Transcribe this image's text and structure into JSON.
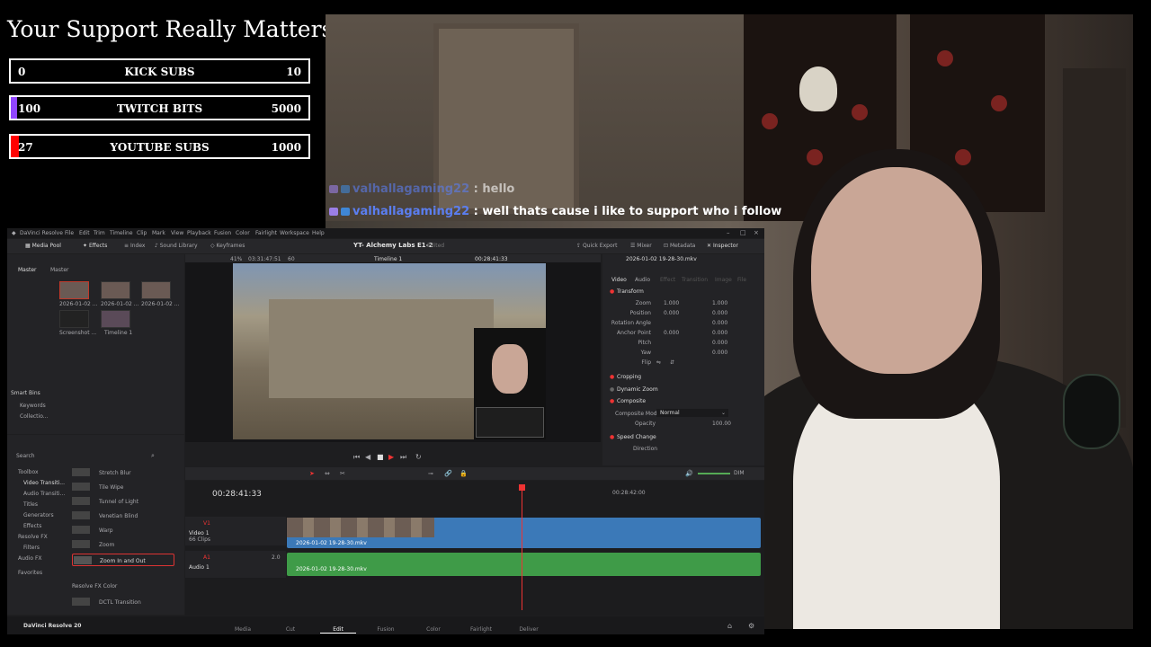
{
  "overlay": {
    "title": "Your Support Really Matters",
    "goals": [
      {
        "start": "0",
        "name": "KICK SUBS",
        "target": "10",
        "progress": 0,
        "color": "#53fc18"
      },
      {
        "start": "100",
        "name": "TWITCH BITS",
        "target": "5000",
        "progress": 0.02,
        "color": "#9146ff"
      },
      {
        "start": "27",
        "name": "YOUTUBE SUBS",
        "target": "1000",
        "progress": 0.027,
        "color": "#ff0000"
      }
    ]
  },
  "chat": [
    {
      "user": "valhallagaming22",
      "sep": " : ",
      "message": "hello"
    },
    {
      "user": "valhallagaming22",
      "sep": " : ",
      "message": "well thats cause i like to support who i follow"
    }
  ],
  "resolve": {
    "menu": [
      "DaVinci Resolve",
      "File",
      "Edit",
      "Trim",
      "Timeline",
      "Clip",
      "Mark",
      "View",
      "Playback",
      "Fusion",
      "Color",
      "Fairlight",
      "Workspace",
      "Help"
    ],
    "toolbar_left": [
      "Media Pool",
      "Effects",
      "Index",
      "Sound Library",
      "Keyframes"
    ],
    "project_title": "YT- Alchemy Labs E1-2",
    "project_status": "Edited",
    "toolbar_right": [
      "Quick Export",
      "Mixer",
      "Metadata",
      "Inspector"
    ],
    "bins": [
      "Master",
      "Master"
    ],
    "clips": [
      "2026-01-02 ...",
      "2026-01-02 ...",
      "2026-01-02 ...",
      "Screenshot ...",
      "Timeline 1"
    ],
    "smart_bins": {
      "title": "Smart Bins",
      "items": [
        "Keywords",
        "Collectio..."
      ]
    },
    "viewer": {
      "zoom": "41%",
      "source_tc": "03:31:47:51",
      "fps": "60",
      "timeline_name": "Timeline 1",
      "timecode": "00:28:41:33"
    },
    "inspector": {
      "clip_name": "2026-01-02 19-28-30.mkv",
      "tabs": [
        "Video",
        "Audio",
        "Effect",
        "Transition",
        "Image",
        "File"
      ],
      "sections": [
        "Transform",
        "Cropping",
        "Dynamic Zoom",
        "Composite",
        "Speed Change"
      ],
      "transform_rows": [
        {
          "label": "Zoom",
          "x": "1.000",
          "y": "1.000"
        },
        {
          "label": "Position",
          "x": "0.000",
          "y": "0.000"
        },
        {
          "label": "Rotation Angle",
          "x": "",
          "y": "0.000"
        },
        {
          "label": "Anchor Point",
          "x": "0.000",
          "y": "0.000"
        },
        {
          "label": "Pitch",
          "x": "",
          "y": "0.000"
        },
        {
          "label": "Yaw",
          "x": "",
          "y": "0.000"
        },
        {
          "label": "Flip",
          "x": "",
          "y": ""
        }
      ],
      "composite_mode_label": "Composite Mode",
      "composite_mode": "Normal",
      "opacity_label": "Opacity",
      "opacity": "100.00",
      "direction_label": "Direction"
    },
    "effects": {
      "search_placeholder": "Search",
      "tree": [
        "Toolbox",
        "Video Transiti...",
        "Audio Transiti...",
        "Titles",
        "Generators",
        "Effects",
        "Resolve FX",
        "Filters",
        "Audio FX",
        "Favorites"
      ],
      "list": [
        "Stretch Blur",
        "Tile Wipe",
        "Tunnel of Light",
        "Venetian Blind",
        "Warp",
        "Zoom",
        "Zoom In and Out"
      ],
      "selected": "Zoom In and Out",
      "section2": "Resolve FX Color",
      "section2_items": [
        "DCTL Transition"
      ]
    },
    "timeline": {
      "timecode": "00:28:41:33",
      "ruler_mark": "00:28:42:00",
      "video_track": {
        "id": "V1",
        "name": "Video 1",
        "clips": "66 Clips"
      },
      "audio_track": {
        "id": "A1",
        "name": "Audio 1",
        "level": "2.0"
      },
      "clip_name": "2026-01-02 19-28-30.mkv",
      "dim": "DIM"
    },
    "pages": [
      "Media",
      "Cut",
      "Edit",
      "Fusion",
      "Color",
      "Fairlight",
      "Deliver"
    ],
    "active_page": "Edit",
    "brand": "DaVinci Resolve 20"
  }
}
